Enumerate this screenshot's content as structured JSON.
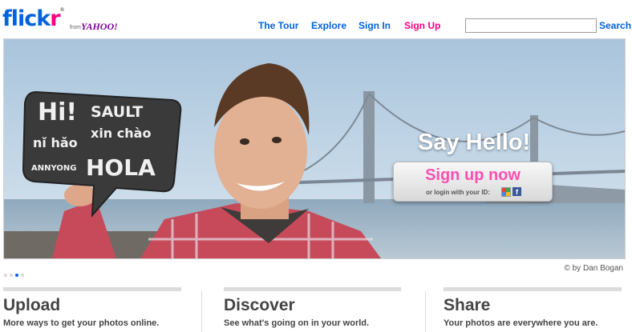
{
  "header": {
    "logo_text_fl": "flick",
    "logo_text_r": "r",
    "logo_reg": "®",
    "from_text": "from",
    "yahoo_text": "YAHOO!",
    "nav": [
      "The Tour",
      "Explore",
      "Sign In",
      "Sign Up"
    ],
    "search_label": "Search",
    "search_value": ""
  },
  "hero": {
    "say_hello": "Say Hello!",
    "signup_now": "Sign up now",
    "login_with": "or login with your ID:",
    "facebook_letter": "f",
    "sign_lines": [
      "Hi!",
      "SAULT",
      "xin chào",
      "nǐ hǎo",
      "ANNYONG",
      "HOLA"
    ]
  },
  "slides": {
    "count": 4,
    "active": 3
  },
  "credit": "© by Dan Bogan",
  "columns": [
    {
      "title": "Upload",
      "subtitle": "More ways to get your photos online."
    },
    {
      "title": "Discover",
      "subtitle": "See what's going on in your world."
    },
    {
      "title": "Share",
      "subtitle": "Your photos are everywhere you are."
    }
  ],
  "colors": {
    "flickr_blue": "#0063dc",
    "flickr_pink": "#ff0084",
    "signup_pink": "#ff4fb0"
  }
}
